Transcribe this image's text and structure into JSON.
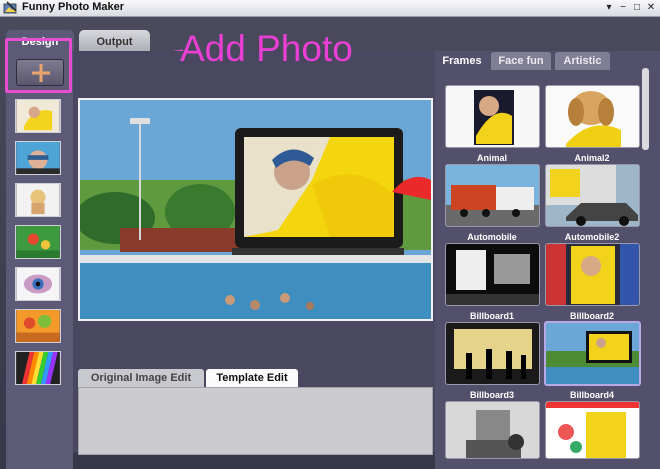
{
  "window": {
    "title": "Funny Photo Maker",
    "icon": "photo-app-icon"
  },
  "controls": {
    "menu": "▾",
    "minimize": "−",
    "maximize": "□",
    "close": "✕"
  },
  "main_tabs": {
    "design": "Design",
    "output": "Output"
  },
  "callout": {
    "text": "Add Photo",
    "color": "#e93fd4"
  },
  "sidebar": {
    "add_icon": "plus-icon",
    "accent": "#e9a56f"
  },
  "edit_tabs": {
    "original": "Original Image Edit",
    "template": "Template Edit"
  },
  "right_tabs": {
    "frames": "Frames",
    "face_fun": "Face fun",
    "artistic": "Artistic"
  },
  "frames": [
    {
      "label": "Animal"
    },
    {
      "label": "Animal2"
    },
    {
      "label": "Automobile"
    },
    {
      "label": "Automobile2"
    },
    {
      "label": "Billboard1"
    },
    {
      "label": "Billboard2"
    },
    {
      "label": "Billboard3"
    },
    {
      "label": "Billboard4"
    },
    {
      "label": ""
    },
    {
      "label": ""
    }
  ]
}
